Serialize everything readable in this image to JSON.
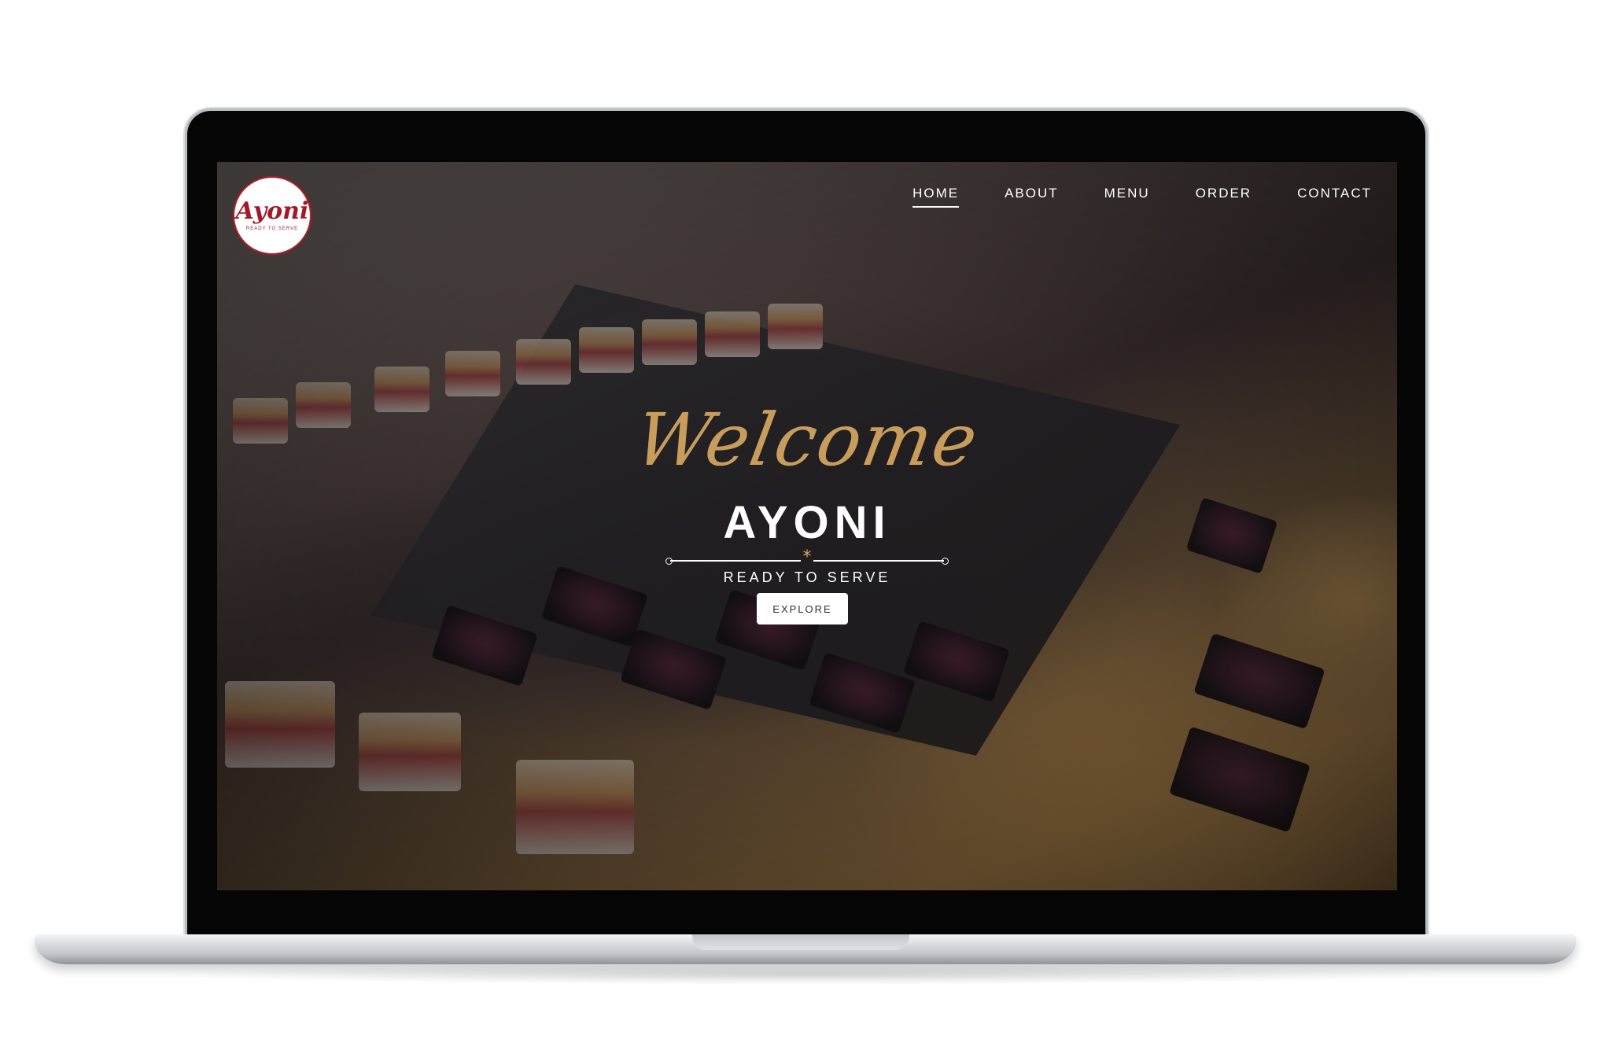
{
  "brand": {
    "logo_text": "Ayoni",
    "logo_subtext": "READY TO SERVE"
  },
  "nav": {
    "items": [
      {
        "label": "HOME",
        "active": true
      },
      {
        "label": "ABOUT",
        "active": false
      },
      {
        "label": "MENU",
        "active": false
      },
      {
        "label": "ORDER",
        "active": false
      },
      {
        "label": "CONTACT",
        "active": false
      }
    ]
  },
  "hero": {
    "script_heading": "Welcome",
    "title": "AYONI",
    "divider_glyph": "*",
    "tagline": "READY TO SERVE",
    "button_label": "EXPLORE"
  },
  "colors": {
    "accent_gold": "#d7a860",
    "logo_red": "#a3192a",
    "text": "#ffffff"
  }
}
